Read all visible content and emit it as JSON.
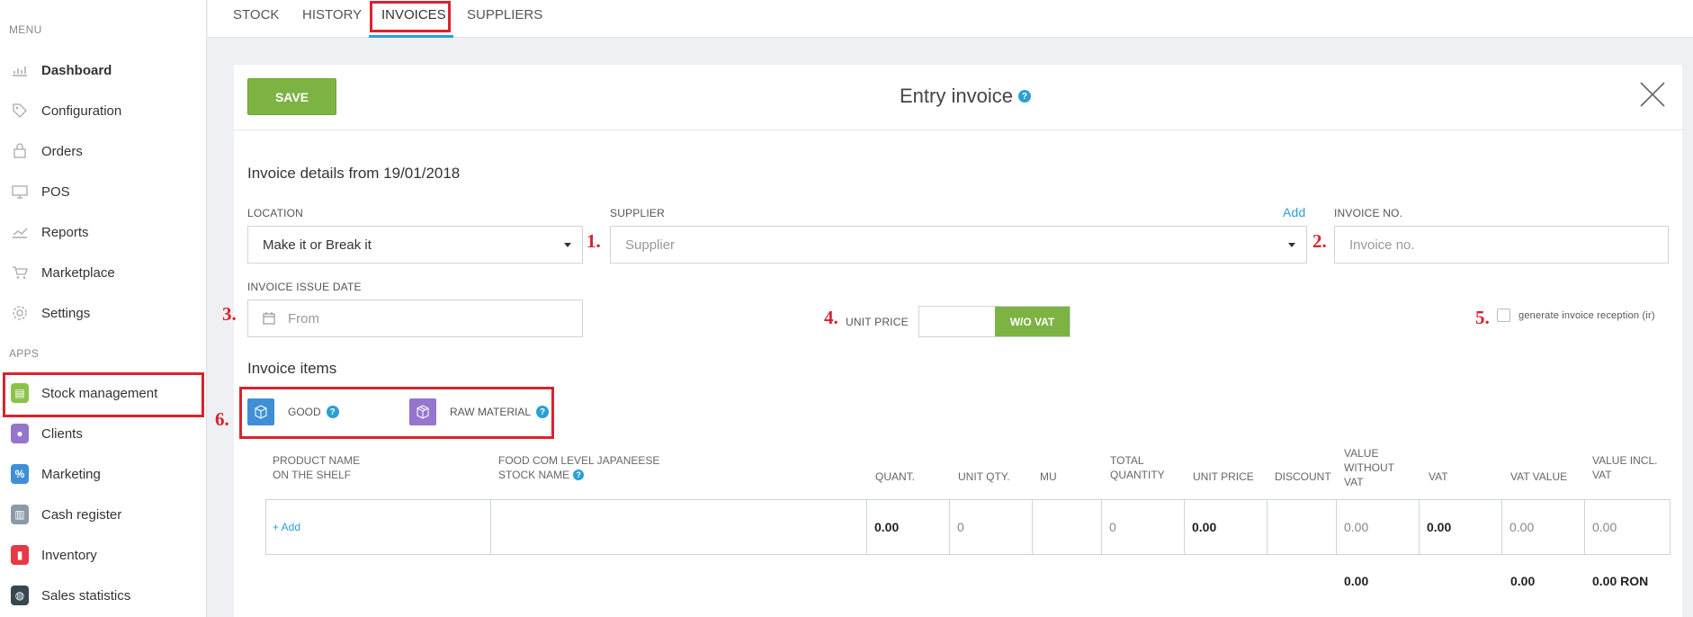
{
  "sidebar": {
    "menu_heading": "MENU",
    "apps_heading": "APPS",
    "menu_items": [
      {
        "label": "Dashboard",
        "icon": "chart-icon"
      },
      {
        "label": "Configuration",
        "icon": "tag-icon"
      },
      {
        "label": "Orders",
        "icon": "bag-icon"
      },
      {
        "label": "POS",
        "icon": "monitor-icon"
      },
      {
        "label": "Reports",
        "icon": "report-icon"
      },
      {
        "label": "Marketplace",
        "icon": "cart-icon"
      },
      {
        "label": "Settings",
        "icon": "gear-icon"
      }
    ],
    "app_items": [
      {
        "label": "Stock management",
        "icon": "stock-icon",
        "color": "#8bc34a"
      },
      {
        "label": "Clients",
        "icon": "clients-icon",
        "color": "#9575cd"
      },
      {
        "label": "Marketing",
        "icon": "marketing-icon",
        "color": "#3f8fd6"
      },
      {
        "label": "Cash register",
        "icon": "cash-register-icon",
        "color": "#8a9aa6"
      },
      {
        "label": "Inventory",
        "icon": "inventory-icon",
        "color": "#e53945"
      },
      {
        "label": "Sales statistics",
        "icon": "sales-icon",
        "color": "#37474f"
      }
    ]
  },
  "tabs": [
    "STOCK",
    "HISTORY",
    "INVOICES",
    "SUPPLIERS"
  ],
  "active_tab": "INVOICES",
  "header": {
    "save_label": "SAVE",
    "title": "Entry invoice",
    "help": "?"
  },
  "form": {
    "details_title": "Invoice details from 19/01/2018",
    "location_label": "LOCATION",
    "location_value": "Make it or Break it",
    "supplier_label": "SUPPLIER",
    "supplier_placeholder": "Supplier",
    "add_link": "Add",
    "invoice_no_label": "INVOICE NO.",
    "invoice_no_placeholder": "Invoice no.",
    "issue_date_label": "INVOICE ISSUE DATE",
    "issue_date_placeholder": "From",
    "unit_price_label": "UNIT PRICE",
    "vat_toggle_label": "W/O VAT",
    "generate_reception_label": "generate invoice reception (ir)",
    "generate_reception_checked": false
  },
  "items": {
    "title": "Invoice items",
    "good_label": "GOOD",
    "raw_material_label": "RAW MATERIAL"
  },
  "table": {
    "headers": {
      "product_name_1": "PRODUCT NAME",
      "product_name_2": "ON THE SHELF",
      "food_1": "FOOD COM LEVEL JAPANEESE",
      "food_2": "STOCK NAME",
      "quant": "QUANT.",
      "unit_qty": "UNIT QTY.",
      "mu": "MU",
      "total_qty_1": "TOTAL",
      "total_qty_2": "QUANTITY",
      "unit_price": "UNIT PRICE",
      "discount": "DISCOUNT",
      "value_wo_vat_1": "VALUE",
      "value_wo_vat_2": "WITHOUT",
      "value_wo_vat_3": "VAT",
      "vat": "VAT",
      "vat_value": "VAT VALUE",
      "value_incl_1": "VALUE INCL.",
      "value_incl_2": "VAT"
    },
    "row": {
      "add_link": "+ Add",
      "quant": "0.00",
      "unit_qty": "0",
      "total_qty": "0",
      "unit_price": "0.00",
      "value_wo_vat": "0.00",
      "vat": "0.00",
      "vat_value": "0.00",
      "value_incl": "0.00"
    },
    "totals": {
      "value_wo_vat": "0.00",
      "vat_value": "0.00",
      "value_incl": "0.00 RON"
    }
  },
  "annotations": [
    "1.",
    "2.",
    "3.",
    "4.",
    "5.",
    "6."
  ]
}
